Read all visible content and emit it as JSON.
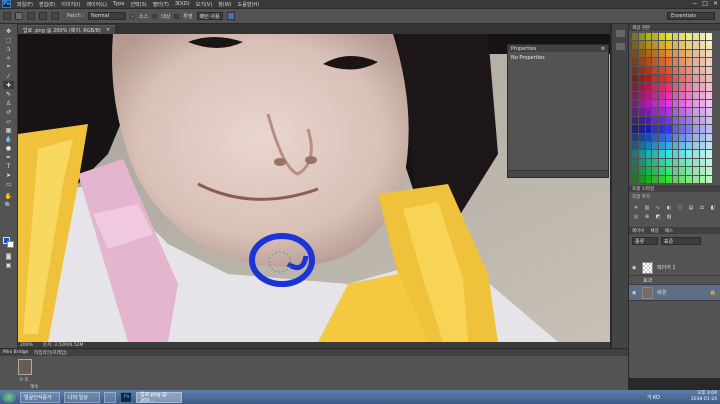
{
  "app": {
    "logo": "Ps"
  },
  "menu": [
    "파일(F)",
    "편집(E)",
    "이미지(I)",
    "레이어(L)",
    "Type",
    "선택(S)",
    "필터(T)",
    "3D(D)",
    "보기(V)",
    "창(W)",
    "도움말(H)"
  ],
  "window_controls": {
    "minimize": "−",
    "maximize": "□",
    "close": "✕"
  },
  "options": {
    "mode_label": "Patch :",
    "mode_value": "Normal",
    "source_label": "소스",
    "dest_label": "대상",
    "transparent_label": "투명",
    "use_pattern_label": "패턴 사용",
    "workspace": "Essentials"
  },
  "document_tab": {
    "title": "업로 .png @ 200% (패치, RGB/8)",
    "close": "×"
  },
  "properties": {
    "title": "Properties",
    "body": "No Properties"
  },
  "right_panels": {
    "swatches_tab": "색상 견본",
    "adjust_tab": "조정  스타일",
    "adjust_add": "조정 추가",
    "layers_tabs": [
      "레이어",
      "채널",
      "패스"
    ],
    "kind_filter": "종류",
    "blend_mode": "표준",
    "layers": [
      {
        "name": "레이어 1",
        "selected": false
      },
      {
        "name": "효과",
        "selected": false
      },
      {
        "name": "배경",
        "selected": true
      }
    ]
  },
  "status": {
    "zoom": "200%",
    "doc": "문서: 3.52M/6.52M"
  },
  "bottom": {
    "tab1": "Mini Bridge",
    "tab2": "타임라인(프레임)",
    "frame_time": "0 초",
    "loop": "계속"
  },
  "taskbar": {
    "items": [
      {
        "label": "얼굴인식증가"
      },
      {
        "label": "나의 일상"
      },
      {
        "label": ""
      },
      {
        "label": "Ps"
      },
      {
        "label": "업로.png @ 200..."
      }
    ],
    "tray_time": "오후 3:04",
    "tray_date": "2018-01-24",
    "lang": "가 KO"
  },
  "colors": {
    "accent": "#0069c8",
    "foreground": "#1a4fc8",
    "background": "#ffffff",
    "scribble": "#1b34d6"
  },
  "icons": [
    "move-icon",
    "marquee-icon",
    "lasso-icon",
    "wand-icon",
    "crop-icon",
    "eyedropper-icon",
    "healing-icon",
    "brush-icon",
    "stamp-icon",
    "history-brush-icon",
    "eraser-icon",
    "gradient-icon",
    "blur-icon",
    "dodge-icon",
    "pen-icon",
    "type-icon",
    "path-select-icon",
    "shape-icon",
    "hand-icon",
    "zoom-icon"
  ]
}
